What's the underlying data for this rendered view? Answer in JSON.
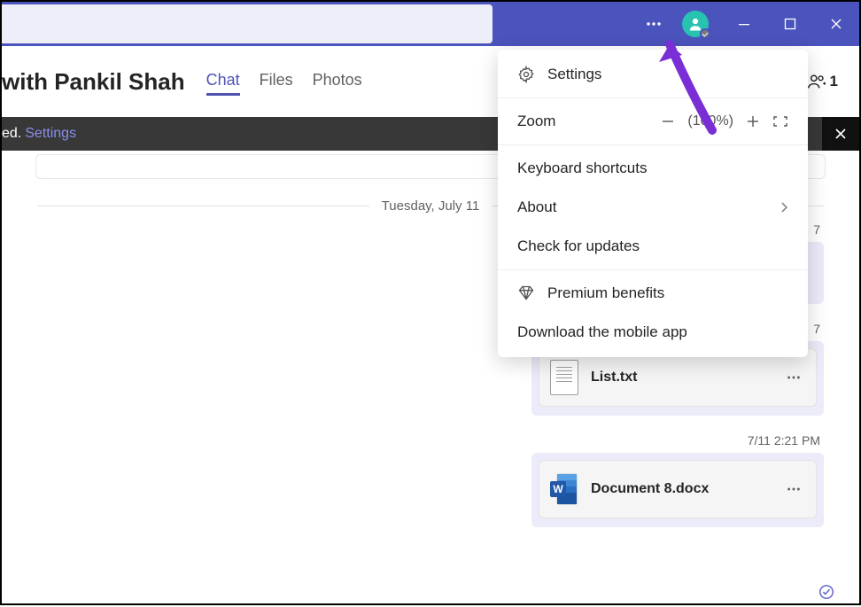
{
  "titlebar": {
    "more_label": "More options"
  },
  "header": {
    "title": "with Pankil Shah",
    "tabs": [
      "Chat",
      "Files",
      "Photos"
    ],
    "active_tab": 0,
    "people_count": "1"
  },
  "notification": {
    "text_suffix": "ed.",
    "link": "Settings"
  },
  "chat": {
    "date_separator": "Tuesday, July 11",
    "msg1_time_partial": "7",
    "msg2_time_partial": "7",
    "file1": "List.txt",
    "msg3_time": "7/11 2:21 PM",
    "file2": "Document 8.docx"
  },
  "menu": {
    "settings": "Settings",
    "zoom_label": "Zoom",
    "zoom_value": "(100%)",
    "keyboard": "Keyboard shortcuts",
    "about": "About",
    "check_updates": "Check for updates",
    "premium": "Premium benefits",
    "download": "Download the mobile app"
  }
}
